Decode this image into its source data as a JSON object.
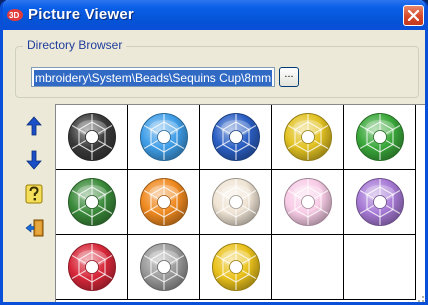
{
  "window": {
    "title": "Picture Viewer",
    "app_icon": "embroidery-app-icon",
    "close_icon": "close-icon"
  },
  "directory": {
    "group_label": "Directory Browser",
    "path": "mbroidery\\System\\Beads\\Sequins Cup\\8mm",
    "browse_label": "..."
  },
  "toolbar": [
    {
      "name": "move-up",
      "icon": "arrow-up-icon",
      "color": "#1a4fc8"
    },
    {
      "name": "move-down",
      "icon": "arrow-down-icon",
      "color": "#1a4fc8"
    },
    {
      "name": "help",
      "icon": "question-icon",
      "color": "#d8b400"
    },
    {
      "name": "exit",
      "icon": "exit-door-icon",
      "color": "#c07a10"
    }
  ],
  "sequins": [
    {
      "name": "black",
      "color": "#3a3a3a"
    },
    {
      "name": "light-blue",
      "color": "#3f9ee8"
    },
    {
      "name": "royal-blue",
      "color": "#2b5fc4"
    },
    {
      "name": "yellow",
      "color": "#e2c222"
    },
    {
      "name": "green",
      "color": "#3aa83a"
    },
    {
      "name": "dark-green",
      "color": "#3a8a3a"
    },
    {
      "name": "orange",
      "color": "#f08a20"
    },
    {
      "name": "ivory",
      "color": "#efe4d4"
    },
    {
      "name": "pink",
      "color": "#f8cce6"
    },
    {
      "name": "lavender",
      "color": "#a77ad6"
    },
    {
      "name": "red",
      "color": "#d8283a"
    },
    {
      "name": "silver",
      "color": "#9a9a9a"
    },
    {
      "name": "gold",
      "color": "#eac21c"
    },
    {
      "name": "empty",
      "color": ""
    },
    {
      "name": "empty",
      "color": ""
    }
  ]
}
